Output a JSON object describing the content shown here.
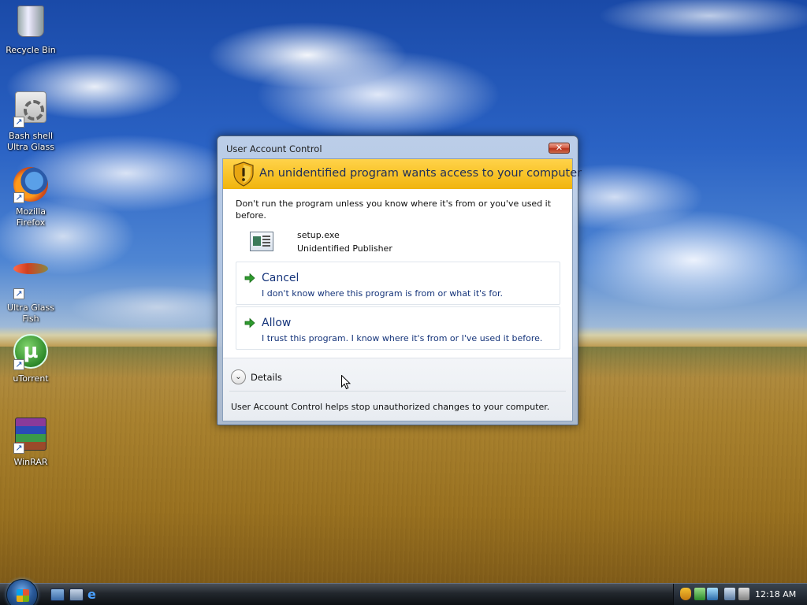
{
  "desktop": {
    "icons": [
      {
        "label": "Recycle Bin",
        "icon": "recycle-bin-icon"
      },
      {
        "label": "Bash shell\nUltra Glass",
        "icon": "settings-gear-icon"
      },
      {
        "label": "Mozilla\nFirefox",
        "icon": "firefox-icon"
      },
      {
        "label": "Ultra Glass\nFish",
        "icon": "fish-icon"
      },
      {
        "label": "uTorrent",
        "icon": "utorrent-icon"
      },
      {
        "label": "WinRAR",
        "icon": "winrar-icon"
      }
    ]
  },
  "dialog": {
    "title": "User Account Control",
    "close_glyph": "✕",
    "banner_text": "An unidentified program wants access to your computer",
    "warning": "Don't run the program unless you know where it's from or you've used it before.",
    "file_name": "setup.exe",
    "publisher": "Unidentified Publisher",
    "cancel": {
      "title": "Cancel",
      "description": "I don't know where this program is from or what it's for."
    },
    "allow": {
      "title": "Allow",
      "description": "I trust this program. I know where it's from or I've used it before."
    },
    "details_label": "Details",
    "footer": "User Account Control helps stop unauthorized changes to your computer.",
    "colors": {
      "banner": "#f8c227",
      "link_text": "#15347a",
      "arrow": "#2e9a2e"
    }
  },
  "taskbar": {
    "clock": "12:18 AM",
    "quick_launch": [
      "show-desktop-icon",
      "switch-windows-icon",
      "internet-explorer-icon"
    ],
    "tray_icons": [
      "security-shield-icon",
      "network-icon",
      "windows-defender-icon",
      "monitor-icon",
      "volume-muted-icon"
    ]
  }
}
